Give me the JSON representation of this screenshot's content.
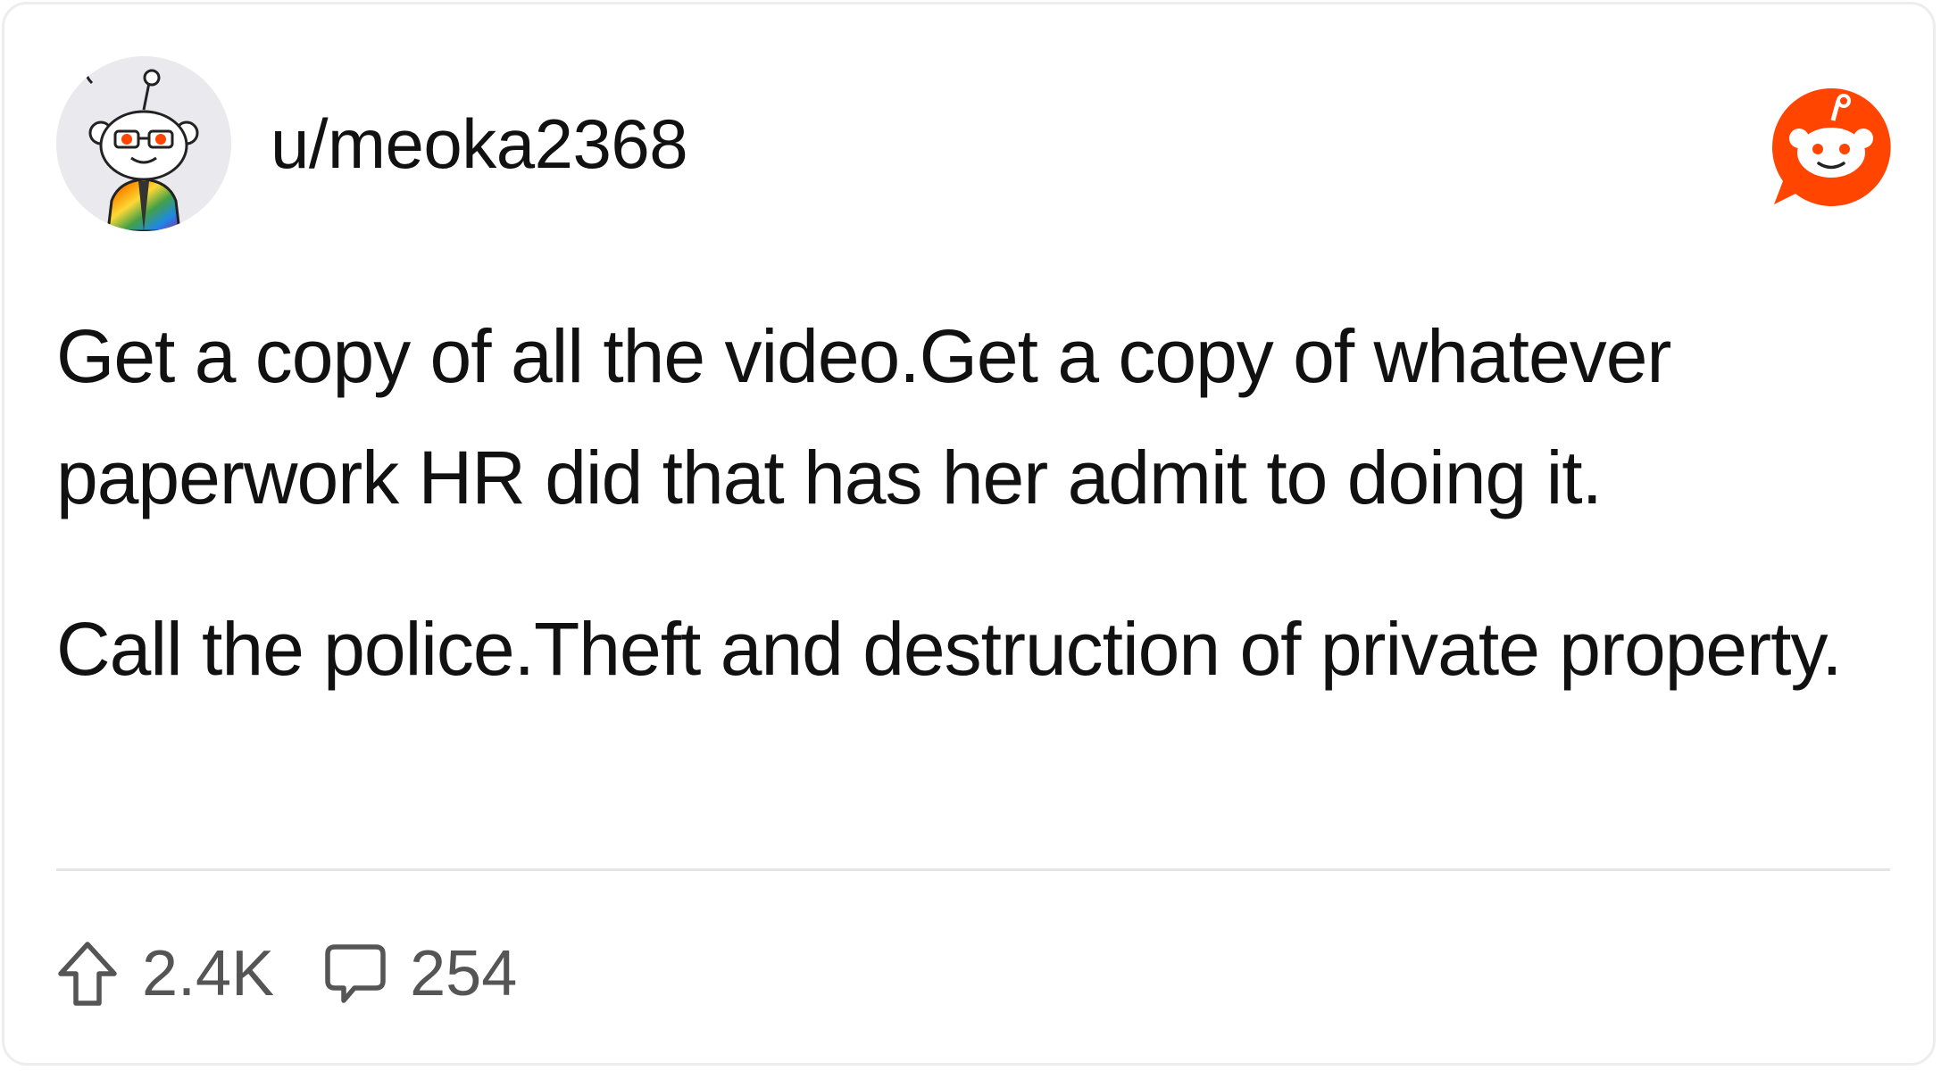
{
  "post": {
    "username": "u/meoka2368",
    "paragraphs": [
      "Get a copy of all the video.Get a copy of whatever paperwork HR did that has her admit to doing it.",
      "Call the police.Theft and destruction of private property."
    ]
  },
  "stats": {
    "upvotes": "2.4K",
    "comments": "254"
  },
  "icons": {
    "avatar": "snoo-avatar-icon",
    "logo": "reddit-logo-icon",
    "upvote": "upvote-arrow-icon",
    "comment": "comment-bubble-icon"
  },
  "colors": {
    "brand": "#ff4500",
    "text": "#111111",
    "muted": "#555555",
    "divider": "#e4e4e4"
  }
}
